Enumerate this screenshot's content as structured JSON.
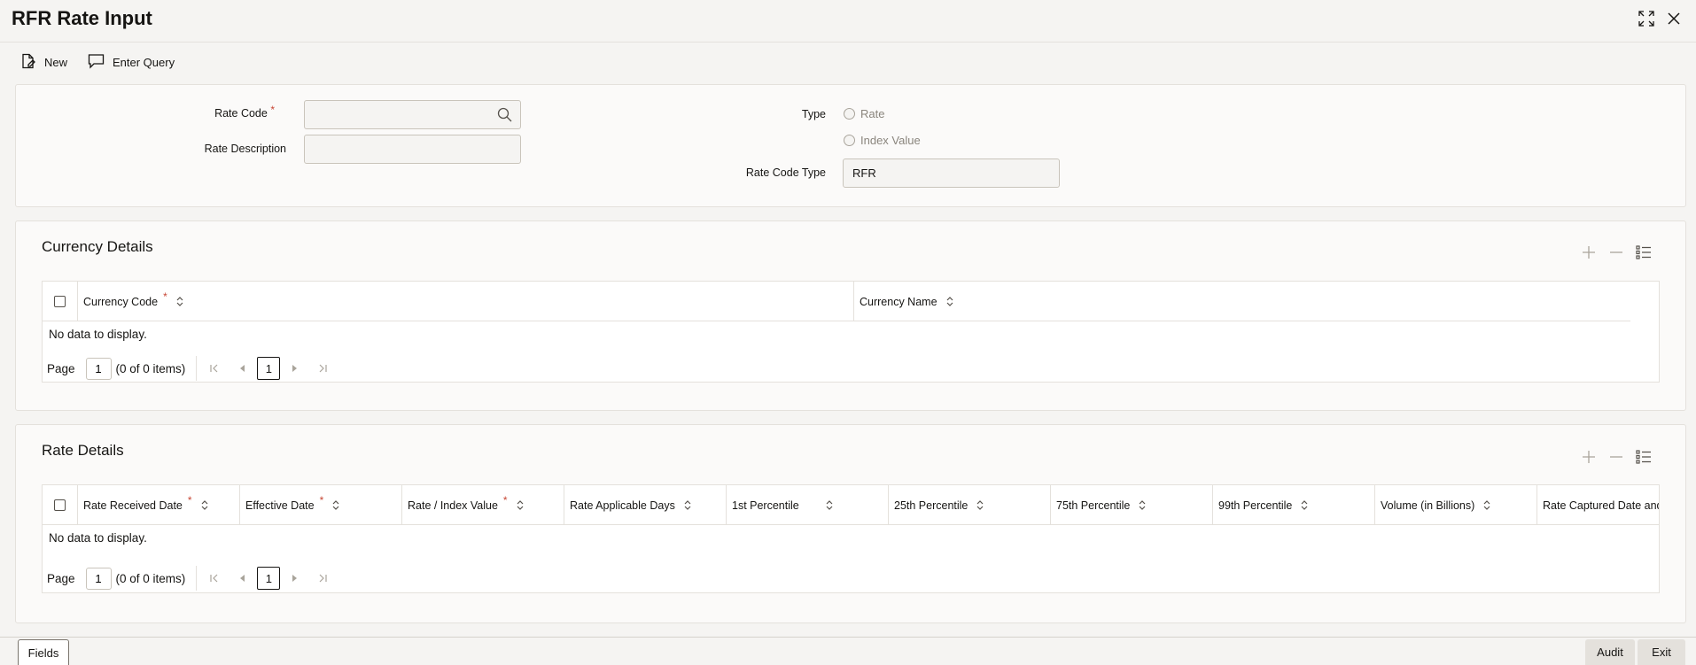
{
  "window": {
    "title": "RFR Rate Input",
    "expand_icon": "expand-icon",
    "close_icon": "close-icon"
  },
  "toolbar": {
    "new_label": "New",
    "enter_query_label": "Enter Query"
  },
  "form": {
    "rate_code_label": "Rate Code",
    "rate_code_value": "",
    "rate_description_label": "Rate Description",
    "rate_description_value": "",
    "type_label": "Type",
    "type_options": [
      "Rate",
      "Index Value"
    ],
    "rate_code_type_label": "Rate Code Type",
    "rate_code_type_value": "RFR",
    "required_mark": "*"
  },
  "currency_details": {
    "title": "Currency Details",
    "columns": [
      {
        "label": "Currency Code",
        "required": true
      },
      {
        "label": "Currency Name",
        "required": false
      }
    ],
    "empty_text": "No data to display.",
    "pager": {
      "page_label": "Page",
      "page_value": "1",
      "items_text": "(0 of 0 items)",
      "current_page": "1"
    }
  },
  "rate_details": {
    "title": "Rate Details",
    "columns": [
      {
        "label": "Rate Received Date",
        "required": true
      },
      {
        "label": "Effective Date",
        "required": true
      },
      {
        "label": "Rate / Index Value",
        "required": true
      },
      {
        "label": "Rate Applicable Days",
        "required": false
      },
      {
        "label": "1st Percentile",
        "required": false
      },
      {
        "label": "25th Percentile",
        "required": false
      },
      {
        "label": "75th Percentile",
        "required": false
      },
      {
        "label": "99th Percentile",
        "required": false
      },
      {
        "label": "Volume (in Billions)",
        "required": false
      },
      {
        "label": "Rate Captured Date and",
        "required": false
      }
    ],
    "empty_text": "No data to display.",
    "pager": {
      "page_label": "Page",
      "page_value": "1",
      "items_text": "(0 of 0 items)",
      "current_page": "1"
    }
  },
  "footer": {
    "fields_label": "Fields",
    "audit_label": "Audit",
    "exit_label": "Exit"
  },
  "colors": {
    "background": "#f5f4f2",
    "panel": "#fbfaf9",
    "required": "#c74634",
    "text": "#161513"
  }
}
